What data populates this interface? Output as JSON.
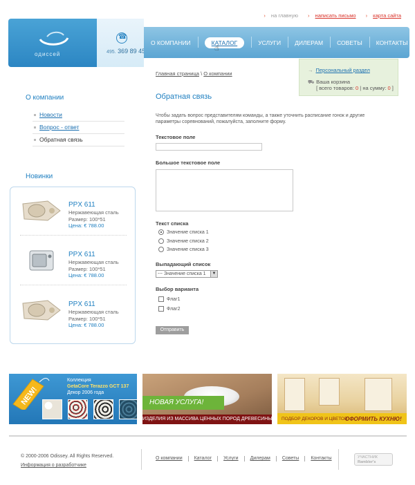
{
  "top_links": {
    "home": "на главную",
    "write": "написать письмо",
    "sitemap": "карта сайта"
  },
  "brand": {
    "logo_text": "одиссей",
    "phone_prefix": "495.",
    "phone": "369 89 45"
  },
  "nav": {
    "items": [
      "О КОМПАНИИ",
      "КАТАЛОГ",
      "УСЛУГИ",
      "ДИЛЕРАМ",
      "СОВЕТЫ",
      "КОНТАКТЫ"
    ],
    "active": "КАТАЛОГ"
  },
  "cart": {
    "personal_link": "Персональный раздел",
    "cart_label": "Ваша корзина",
    "total_items_label": "[ всего товаров:",
    "total_items": "0",
    "sum_label": "| на сумму:",
    "sum": "0",
    "close": "]"
  },
  "breadcrumb": {
    "home": "Главная страница",
    "sep": "\\",
    "current": "О компании"
  },
  "sidebar": {
    "title": "О компании",
    "items": [
      {
        "label": "Новости"
      },
      {
        "label": "Вопрос - ответ"
      },
      {
        "label": "Обратная связь"
      }
    ],
    "new_title": "Новинки"
  },
  "products": [
    {
      "name": "PPX 611",
      "material": "Нержавеющая сталь",
      "size": "Размер: 100*51",
      "price": "Цена: € 788.00",
      "icon": "corner-sink-icon"
    },
    {
      "name": "PPX 611",
      "material": "Нержавеющая сталь",
      "size": "Размер: 100*51",
      "price": "Цена: € 788.00",
      "icon": "steel-sink-icon"
    },
    {
      "name": "PPX 611",
      "material": "Нержавеющая сталь",
      "size": "Размер: 100*51",
      "price": "Цена: € 788.00",
      "icon": "corner-sink-icon"
    }
  ],
  "form": {
    "title": "Обратная связь",
    "intro": "Чтобы задать вопрос представителям команды, а также уточнить расписание гонок и другие параметры соревнований, пожалуйста, заполните форму.",
    "text_label": "Текстовое поле",
    "textarea_label": "Большое текстовое поле",
    "radio_label": "Текст списка",
    "radios": [
      "Значение списка 1",
      "Значение списка 2",
      "Значение списка 3"
    ],
    "select_label": "Выпадающий список",
    "select_value": "--- Значение списка 1",
    "checkbox_label": "Выбор варианта",
    "checkboxes": [
      "Флаг1",
      "Флаг2"
    ],
    "submit": "Отправить"
  },
  "banners": {
    "b1_new": "NEW!",
    "b1_line1": "Коллекция",
    "b1_line2": "GetaCore Terazzo GCT 137",
    "b1_line3": "Декор 2006 года",
    "b2_title": "НОВАЯ УСЛУГА!",
    "b2_sub": "ИЗДЕЛИЯ ИЗ МАССИВА ЦЕННЫХ ПОРОД ДРЕВЕСИНЫ",
    "b3_left": "ПОДБОР ДЕКОРОВ И ЦВЕТОВ",
    "b3_right": "ОФОРМИТЬ КУХНЮ!"
  },
  "footer": {
    "copyright": "© 2000-2006 Odissey. All Rights Reserved.",
    "developer": "Информация о разработчике",
    "links": [
      "О компании",
      "Каталог",
      "Услуги",
      "Дилерам",
      "Советы",
      "Контакты"
    ],
    "badge_line1": "УЧАСТНИК",
    "badge_line2": "Rambler's"
  },
  "colors": {
    "accent": "#1e7fc0",
    "header_blue": "#2c86c3",
    "link_red": "#d9332a",
    "cart_bg": "#e7f1dd"
  }
}
